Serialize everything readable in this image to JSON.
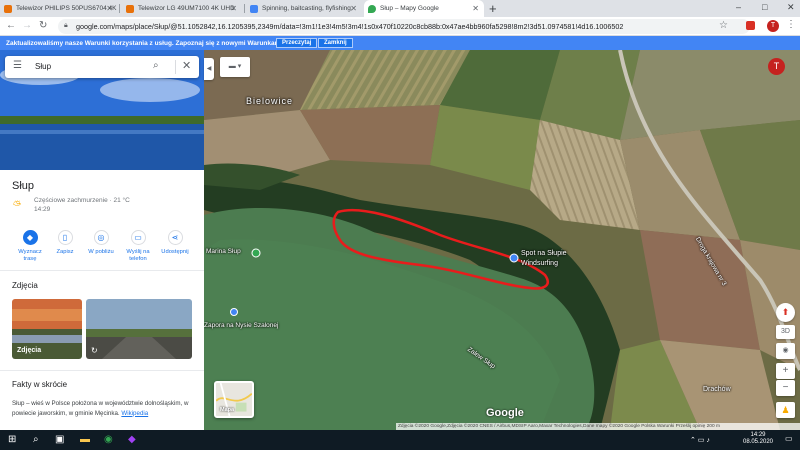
{
  "browser": {
    "tabs": [
      {
        "title": "Telewizor PHILIPS 50PUS6704 4K",
        "active": false
      },
      {
        "title": "Telewizor LG 49UM7100 4K UHD",
        "active": false
      },
      {
        "title": "Spinning, baitcasting, flyfishing,",
        "active": false
      },
      {
        "title": "Słup – Mapy Google",
        "active": true
      }
    ],
    "new_tab": "+",
    "window_controls": [
      "–",
      "□",
      "✕"
    ],
    "url": "google.com/maps/place/Słup/@51.1052842,16.1205395,2349m/data=!3m1!1e3!4m5!3m4!1s0x470f10220c8cb88b:0x47ae4bb960fa5298!8m2!3d51.0974581!4d16.1006502",
    "profile_initial": "T"
  },
  "banner": {
    "text": "Zaktualizowaliśmy nasze Warunki korzystania z usług. Zapoznaj się z nowymi Warunkami",
    "review_label": "Przeczytaj",
    "dismiss_label": "Zamknij"
  },
  "panel": {
    "search_value": "Słup",
    "title": "Słup",
    "weather": "Częściowe zachmurzenie · 21 °C\n14:29",
    "actions": [
      {
        "label": "Wyznacz trasę",
        "icon": "directions-icon"
      },
      {
        "label": "Zapisz",
        "icon": "bookmark-icon"
      },
      {
        "label": "W pobliżu",
        "icon": "nearby-icon"
      },
      {
        "label": "Wyślij na telefon",
        "icon": "phone-icon"
      },
      {
        "label": "Udostępnij",
        "icon": "share-icon"
      }
    ],
    "photos_heading": "Zdjęcia",
    "photo_label": "Zdjęcia",
    "facts_heading": "Fakty w skrócie",
    "facts_text": "Słup – wieś w Polsce położona w województwie dolnośląskim, w powiecie jaworskim, w gminie Męcinka.",
    "facts_link": "Wikipedia"
  },
  "map": {
    "labels": {
      "bielowice": "Bielowice",
      "marina": "Marina Słup",
      "spot_line1": "Spot na Słupie",
      "spot_line2": "Windsurfing",
      "nysa": "Zapora na Nysie Szalonej",
      "zalew": "Zalew Słup",
      "drogowa": "Droga krajowa nr 3",
      "drachow": "Drachów"
    },
    "mapa_label": "Mapa",
    "google_logo": "Google",
    "attribution": "Zdjęcia ©2020 Google,Zdjęcia ©2020 CNES / Airbus,MDSIP Aaro,Maxar Technologies,Dane mapy ©2020 Google   Polska   Warunki   Prześlij opinię   200 m",
    "controls": {
      "rotate": "3D"
    }
  },
  "taskbar": {
    "time": "14:29",
    "date": "08.05.2020"
  }
}
